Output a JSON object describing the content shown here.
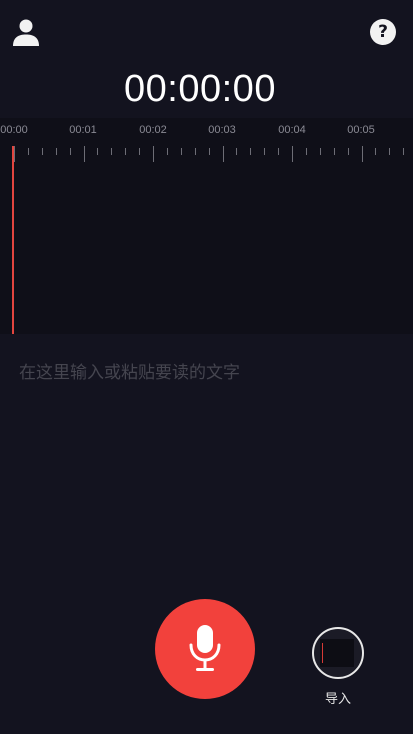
{
  "header": {
    "profile_icon": "user-icon",
    "help_icon": "help-icon",
    "help_glyph": "?"
  },
  "timer": {
    "value": "00:00:00"
  },
  "waveform": {
    "tick_labels": [
      "00:00",
      "00:01",
      "00:02",
      "00:03",
      "00:04",
      "00:05"
    ],
    "playhead_color": "#e2453f",
    "background_color": "#0f0f18"
  },
  "editor": {
    "placeholder": "在这里输入或粘贴要读的文字"
  },
  "controls": {
    "record_icon": "microphone-icon",
    "record_color": "#f2413c",
    "import_label": "导入"
  },
  "colors": {
    "background": "#13131f",
    "accent": "#f2413c"
  }
}
